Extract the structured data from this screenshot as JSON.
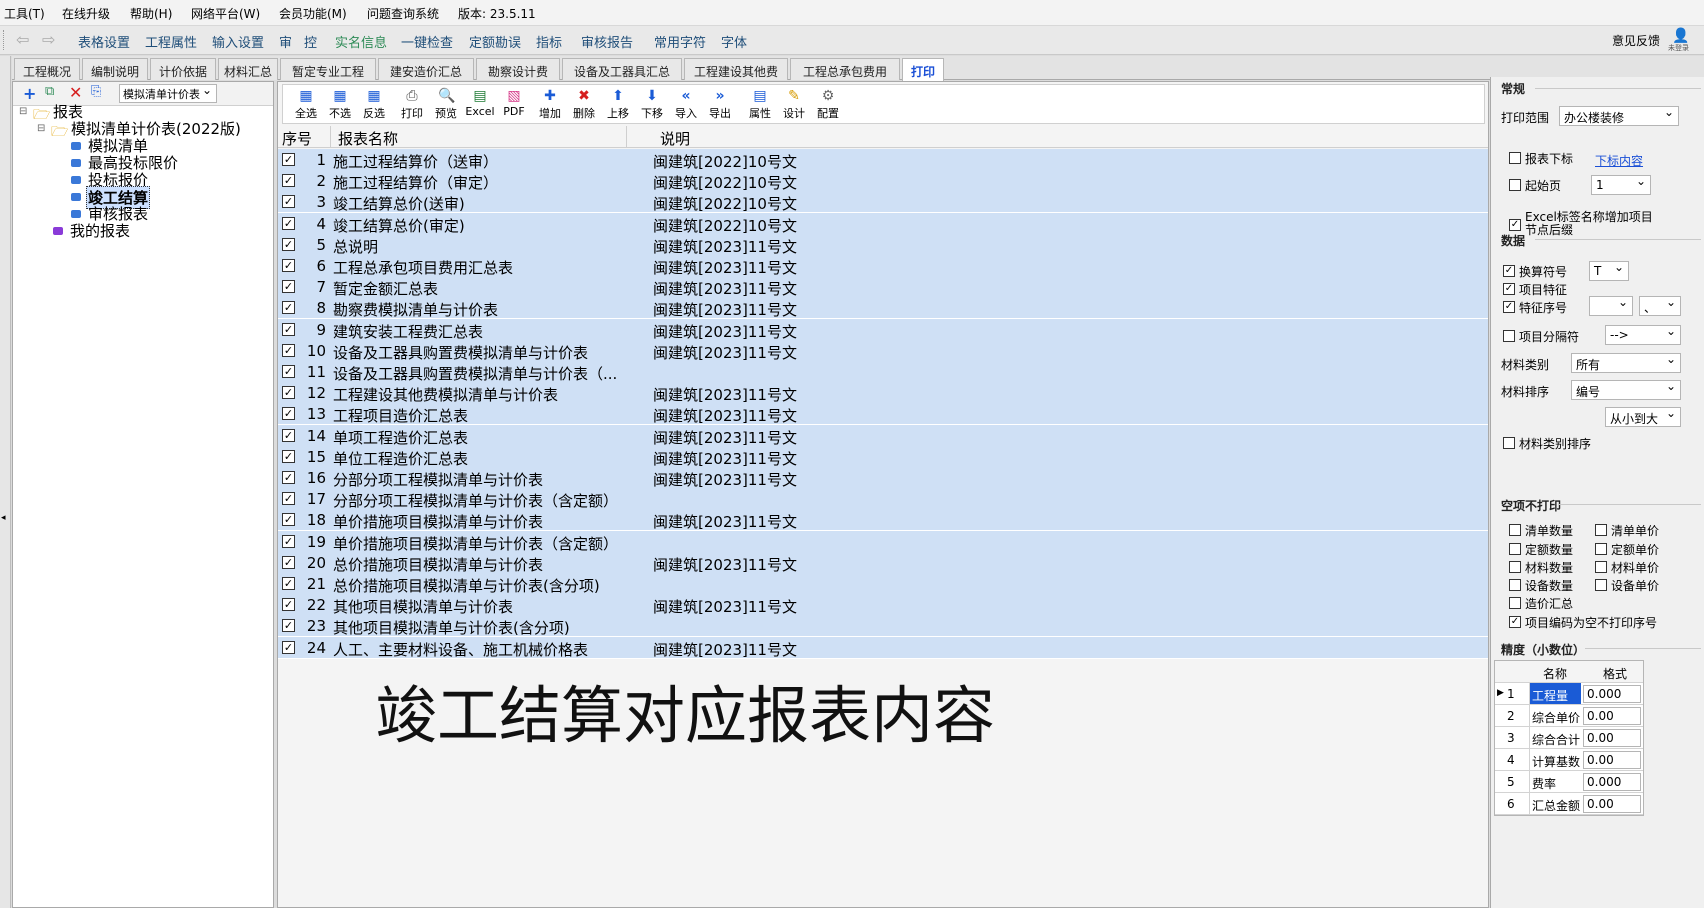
{
  "menu": [
    "工具(T)",
    "在线升级",
    "帮助(H)",
    "网络平台(W)",
    "会员功能(M)",
    "问题查询系统",
    "版本: 23.5.11"
  ],
  "toolbar": {
    "items": [
      "表格设置",
      "工程属性",
      "输入设置",
      "审",
      "控",
      "实名信息",
      "一键检查",
      "定额勘误",
      "指标",
      "审核报告",
      "常用字符",
      "字体"
    ],
    "feedback": "意见反馈",
    "user": "未登录"
  },
  "tabs": [
    "工程概况",
    "编制说明",
    "计价依据",
    "材料汇总",
    "暂定专业工程",
    "建安造价汇总",
    "勘察设计费",
    "设备及工器具汇总",
    "工程建设其他费",
    "工程总承包费用",
    "打印"
  ],
  "left": {
    "dropdown": "模拟清单计价表",
    "tree": {
      "root": "报表",
      "group": "模拟清单计价表(2022版)",
      "children": [
        "模拟清单",
        "最高投标限价",
        "投标报价",
        "竣工结算",
        "审核报表"
      ],
      "mine": "我的报表"
    }
  },
  "report_toolbar": [
    "全选",
    "不选",
    "反选",
    "打印",
    "预览",
    "Excel",
    "PDF",
    "增加",
    "删除",
    "上移",
    "下移",
    "导入",
    "导出",
    "属性",
    "设计",
    "配置"
  ],
  "table": {
    "headers": [
      "序号",
      "报表名称",
      "说明"
    ],
    "rows": [
      {
        "n": "1",
        "name": "施工过程结算价（送审）",
        "desc": "闽建筑[2022]10号文"
      },
      {
        "n": "2",
        "name": "施工过程结算价（审定）",
        "desc": "闽建筑[2022]10号文"
      },
      {
        "n": "3",
        "name": "竣工结算总价(送审)",
        "desc": "闽建筑[2022]10号文"
      },
      {
        "n": "4",
        "name": "竣工结算总价(审定)",
        "desc": "闽建筑[2022]10号文"
      },
      {
        "n": "5",
        "name": "总说明",
        "desc": "闽建筑[2023]11号文"
      },
      {
        "n": "6",
        "name": "工程总承包项目费用汇总表",
        "desc": "闽建筑[2023]11号文"
      },
      {
        "n": "7",
        "name": "暂定金额汇总表",
        "desc": "闽建筑[2023]11号文"
      },
      {
        "n": "8",
        "name": "勘察费模拟清单与计价表",
        "desc": "闽建筑[2023]11号文"
      },
      {
        "n": "9",
        "name": "建筑安装工程费汇总表",
        "desc": "闽建筑[2023]11号文"
      },
      {
        "n": "10",
        "name": "设备及工器具购置费模拟清单与计价表",
        "desc": "闽建筑[2023]11号文"
      },
      {
        "n": "11",
        "name": "设备及工器具购置费模拟清单与计价表（...",
        "desc": ""
      },
      {
        "n": "12",
        "name": "工程建设其他费模拟清单与计价表",
        "desc": "闽建筑[2023]11号文"
      },
      {
        "n": "13",
        "name": "工程项目造价汇总表",
        "desc": "闽建筑[2023]11号文"
      },
      {
        "n": "14",
        "name": "单项工程造价汇总表",
        "desc": "闽建筑[2023]11号文"
      },
      {
        "n": "15",
        "name": "单位工程造价汇总表",
        "desc": "闽建筑[2023]11号文"
      },
      {
        "n": "16",
        "name": "分部分项工程模拟清单与计价表",
        "desc": "闽建筑[2023]11号文"
      },
      {
        "n": "17",
        "name": "分部分项工程模拟清单与计价表（含定额）",
        "desc": ""
      },
      {
        "n": "18",
        "name": "单价措施项目模拟清单与计价表",
        "desc": "闽建筑[2023]11号文"
      },
      {
        "n": "19",
        "name": "单价措施项目模拟清单与计价表（含定额）",
        "desc": ""
      },
      {
        "n": "20",
        "name": "总价措施项目模拟清单与计价表",
        "desc": "闽建筑[2023]11号文"
      },
      {
        "n": "21",
        "name": "总价措施项目模拟清单与计价表(含分项)",
        "desc": ""
      },
      {
        "n": "22",
        "name": "其他项目模拟清单与计价表",
        "desc": "闽建筑[2023]11号文"
      },
      {
        "n": "23",
        "name": "其他项目模拟清单与计价表(含分项)",
        "desc": ""
      },
      {
        "n": "24",
        "name": "人工、主要材料设备、施工机械价格表",
        "desc": "闽建筑[2023]11号文"
      }
    ]
  },
  "overlay_text": "竣工结算对应报表内容",
  "right": {
    "general": "常规",
    "print_range_label": "打印范围",
    "print_range_value": "办公楼装修",
    "report_mark_label": "报表下标",
    "report_mark_link": "下标内容",
    "start_page_label": "起始页",
    "start_page_value": "1",
    "excel_label": "Excel标签名称增加项目节点后缀",
    "data": "数据",
    "conv_symbol": "换算符号",
    "conv_value": "T",
    "item_feature": "项目特征",
    "feature_no": "特征序号",
    "feature_sep": "、",
    "item_sep": "项目分隔符",
    "item_sep_value": "-->",
    "mat_type_label": "材料类别",
    "mat_type_value": "所有",
    "mat_sort_label": "材料排序",
    "mat_sort_value": "编号",
    "order_value": "从小到大",
    "mat_type_sort": "材料类别排序",
    "empty_title": "空项不打印",
    "empty_items": [
      "清单数量",
      "清单单价",
      "定额数量",
      "定额单价",
      "材料数量",
      "材料单价",
      "设备数量",
      "设备单价",
      "造价汇总"
    ],
    "empty_last": "项目编码为空不打印序号",
    "precision": "精度（小数位）",
    "prec_headers": [
      "名称",
      "格式"
    ],
    "prec_rows": [
      {
        "n": "1",
        "name": "工程量",
        "fmt": "0.000"
      },
      {
        "n": "2",
        "name": "综合单价",
        "fmt": "0.00"
      },
      {
        "n": "3",
        "name": "综合合计",
        "fmt": "0.00"
      },
      {
        "n": "4",
        "name": "计算基数",
        "fmt": "0.00"
      },
      {
        "n": "5",
        "name": "费率",
        "fmt": "0.000"
      },
      {
        "n": "6",
        "name": "汇总金额",
        "fmt": "0.00"
      }
    ]
  }
}
